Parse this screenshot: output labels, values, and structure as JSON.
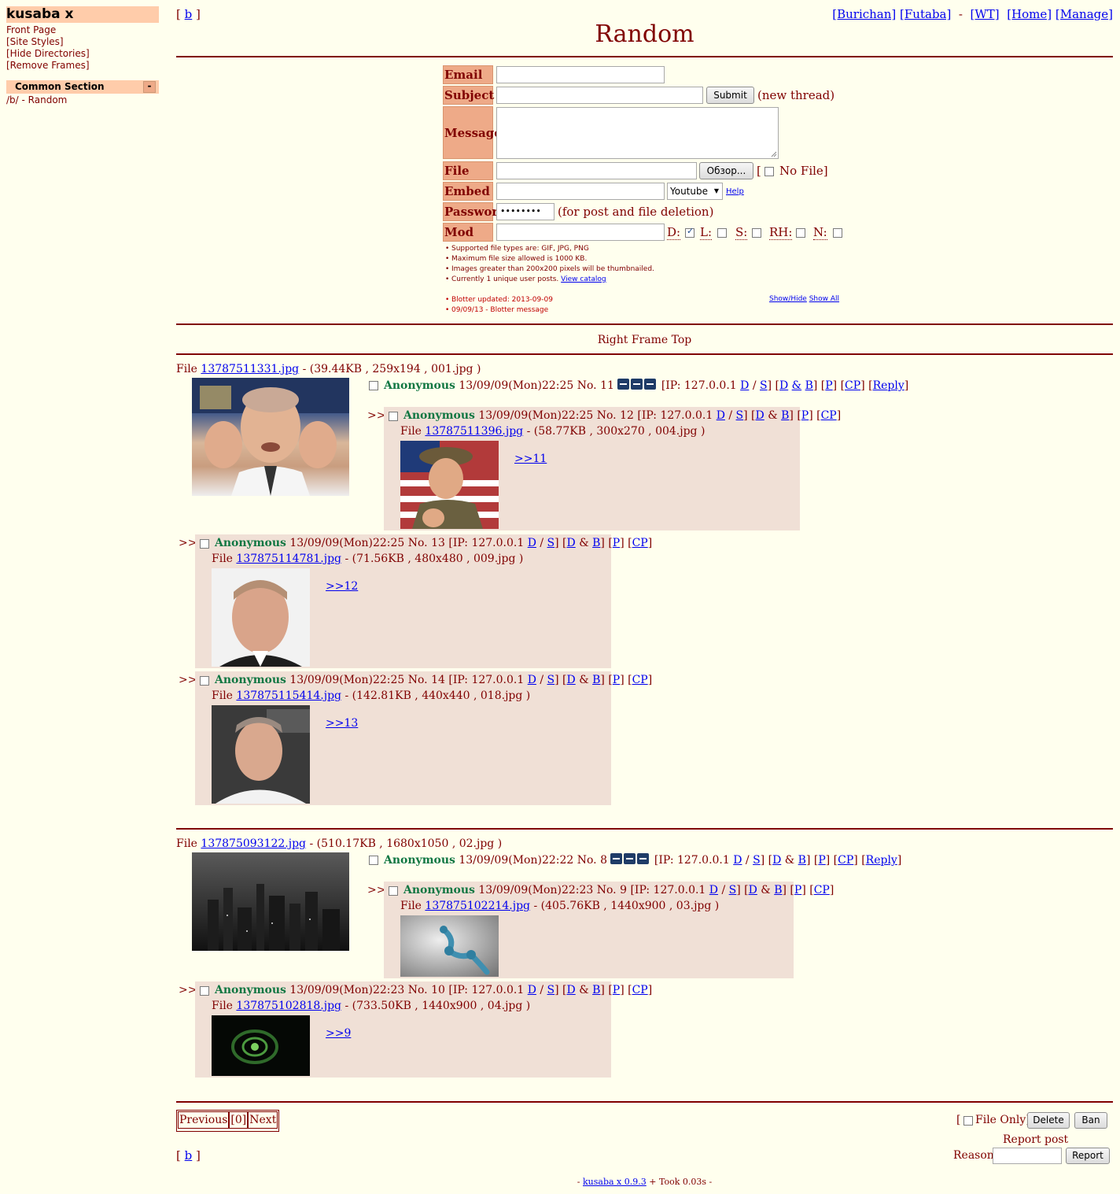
{
  "sidebar": {
    "logo": "kusaba x",
    "links": [
      "Front Page",
      "[Site Styles]",
      "[Hide Directories]",
      "[Remove Frames]"
    ],
    "section_title": "Common Section",
    "section_toggle": "-",
    "board_link": "/b/ - Random"
  },
  "header": {
    "board_nav_open": "[",
    "board_nav_letter": "b",
    "board_nav_close": "]",
    "right_links": [
      "[Burichan]",
      "[Futaba]",
      "-",
      "[WT]",
      "[Home]",
      "[Manage]"
    ],
    "title": "Random"
  },
  "form": {
    "labels": {
      "email": "Email",
      "subject": "Subject",
      "message": "Message",
      "file": "File",
      "embed": "Embed",
      "password": "Password",
      "mod": "Mod"
    },
    "submit_label": "Submit",
    "new_thread_note": "(new thread)",
    "browse_label": "Обзор...",
    "no_file_open": "[",
    "no_file_label": "No File]",
    "embed_select_value": "Youtube",
    "help_link": "Help",
    "password_value": "••••••••",
    "password_note": "(for post and file deletion)",
    "mod_flags": [
      {
        "label": "D:",
        "checked": true
      },
      {
        "label": "L:",
        "checked": false
      },
      {
        "label": "S:",
        "checked": false
      },
      {
        "label": "RH:",
        "checked": false
      },
      {
        "label": "N:",
        "checked": false
      }
    ],
    "rules": [
      "Supported file types are: GIF, JPG, PNG",
      "Maximum file size allowed is 1000 KB.",
      "Images greater than 200x200 pixels will be thumbnailed.",
      "Currently 1 unique user posts."
    ],
    "view_catalog": "View catalog",
    "blotter": [
      "Blotter updated: 2013-09-09",
      "09/09/13 - Blotter message"
    ],
    "show_hide": "Show/Hide",
    "show_all": "Show All"
  },
  "right_frame_top": "Right Frame Top",
  "threads": [
    {
      "op": {
        "file_prefix": "File",
        "file_link": "13787511331.jpg",
        "file_info": "- (39.44KB , 259x194 , 001.jpg )",
        "name": "Anonymous",
        "date": "13/09/09(Mon)22:25",
        "no": "No. 11",
        "ip": "[IP: 127.0.0.1",
        "reply": "Reply"
      },
      "replies": [
        {
          "name": "Anonymous",
          "date": "13/09/09(Mon)22:25",
          "no": "No. 12",
          "file_link": "13787511396.jpg",
          "file_info": "- (58.77KB , 300x270 , 004.jpg )",
          "quote": ">>11"
        },
        {
          "name": "Anonymous",
          "date": "13/09/09(Mon)22:25",
          "no": "No. 13",
          "file_link": "137875114781.jpg",
          "file_info": "- (71.56KB , 480x480 , 009.jpg )",
          "quote": ">>12"
        },
        {
          "name": "Anonymous",
          "date": "13/09/09(Mon)22:25",
          "no": "No. 14",
          "file_link": "137875115414.jpg",
          "file_info": "- (142.81KB , 440x440 , 018.jpg )",
          "quote": ">>13"
        }
      ]
    },
    {
      "op": {
        "file_prefix": "File",
        "file_link": "137875093122.jpg",
        "file_info": "- (510.17KB , 1680x1050 , 02.jpg )",
        "name": "Anonymous",
        "date": "13/09/09(Mon)22:22",
        "no": "No. 8",
        "ip": "[IP: 127.0.0.1",
        "reply": "Reply"
      },
      "replies": [
        {
          "name": "Anonymous",
          "date": "13/09/09(Mon)22:23",
          "no": "No. 9",
          "file_link": "137875102214.jpg",
          "file_info": "- (405.76KB , 1440x900 , 03.jpg )",
          "quote": ""
        },
        {
          "name": "Anonymous",
          "date": "13/09/09(Mon)22:23",
          "no": "No. 10",
          "file_link": "137875102818.jpg",
          "file_info": "- (733.50KB , 1440x900 , 04.jpg )",
          "quote": ">>9"
        }
      ]
    }
  ],
  "post_links": {
    "d": "D",
    "slash": "/",
    "s": "S",
    "db": "D",
    "amp": "&",
    "b": "B",
    "p": "P",
    "cp": "CP"
  },
  "reply_arrow": ">>",
  "pager": {
    "previous": "Previous",
    "current": "[0]",
    "next": "Next"
  },
  "delete_area": {
    "file_only_open": "[",
    "file_only": "File Only]",
    "delete": "Delete",
    "ban": "Ban",
    "report_title": "Report post",
    "reason_label": "Reason",
    "report": "Report"
  },
  "footer": {
    "prefix": "-",
    "link": "kusaba x 0.9.3",
    "suffix": "+ Took 0.03s -"
  }
}
